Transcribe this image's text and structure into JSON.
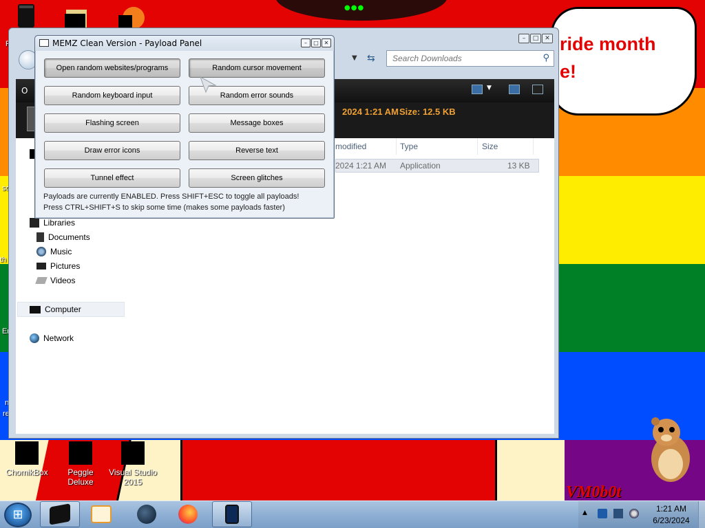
{
  "desktop": {
    "speech_line1": "ride month",
    "speech_line2": "e!",
    "icons": [
      {
        "label": "ChomikBox"
      },
      {
        "label": "Peggle Deluxe"
      },
      {
        "label": "Visual Studio 2015"
      }
    ],
    "partial_labels": [
      "P",
      "O",
      "so",
      "th",
      "Er",
      "n",
      "re"
    ],
    "vm_logo": "VM0b0t",
    "flag_colors": [
      "#e40303",
      "#ff8c00",
      "#ffed00",
      "#008026",
      "#004dff",
      "#750787"
    ]
  },
  "explorer": {
    "search_placeholder": "Search Downloads",
    "toolbar_label": "O",
    "details": {
      "date": "2024 1:21 AM",
      "size": "Size: 12.5 KB"
    },
    "columns": [
      "modified",
      "Type",
      "Size"
    ],
    "file": {
      "modified": "2024 1:21 AM",
      "type": "Application",
      "size": "13 KB"
    },
    "nav": {
      "libraries": "Libraries",
      "documents": "Documents",
      "music": "Music",
      "pictures": "Pictures",
      "videos": "Videos",
      "computer": "Computer",
      "network": "Network"
    }
  },
  "memz": {
    "title": "MEMZ Clean Version - Payload Panel",
    "buttons": [
      {
        "label": "Open random websites/programs",
        "pressed": true
      },
      {
        "label": "Random cursor movement",
        "pressed": true
      },
      {
        "label": "Random keyboard input",
        "pressed": false
      },
      {
        "label": "Random error sounds",
        "pressed": false
      },
      {
        "label": "Flashing screen",
        "pressed": false
      },
      {
        "label": "Message boxes",
        "pressed": false
      },
      {
        "label": "Draw error icons",
        "pressed": false
      },
      {
        "label": "Reverse text",
        "pressed": false
      },
      {
        "label": "Tunnel effect",
        "pressed": false
      },
      {
        "label": "Screen glitches",
        "pressed": false
      }
    ],
    "status_line1": "Payloads are currently ENABLED. Press SHIFT+ESC to toggle all payloads!",
    "status_line2": "Press CTRL+SHIFT+S to skip some time (makes some payloads faster)"
  },
  "taskbar": {
    "time": "1:21 AM",
    "date": "6/23/2024",
    "tasks": [
      "explorer",
      "media-player",
      "steam",
      "firefox",
      "memz"
    ]
  }
}
